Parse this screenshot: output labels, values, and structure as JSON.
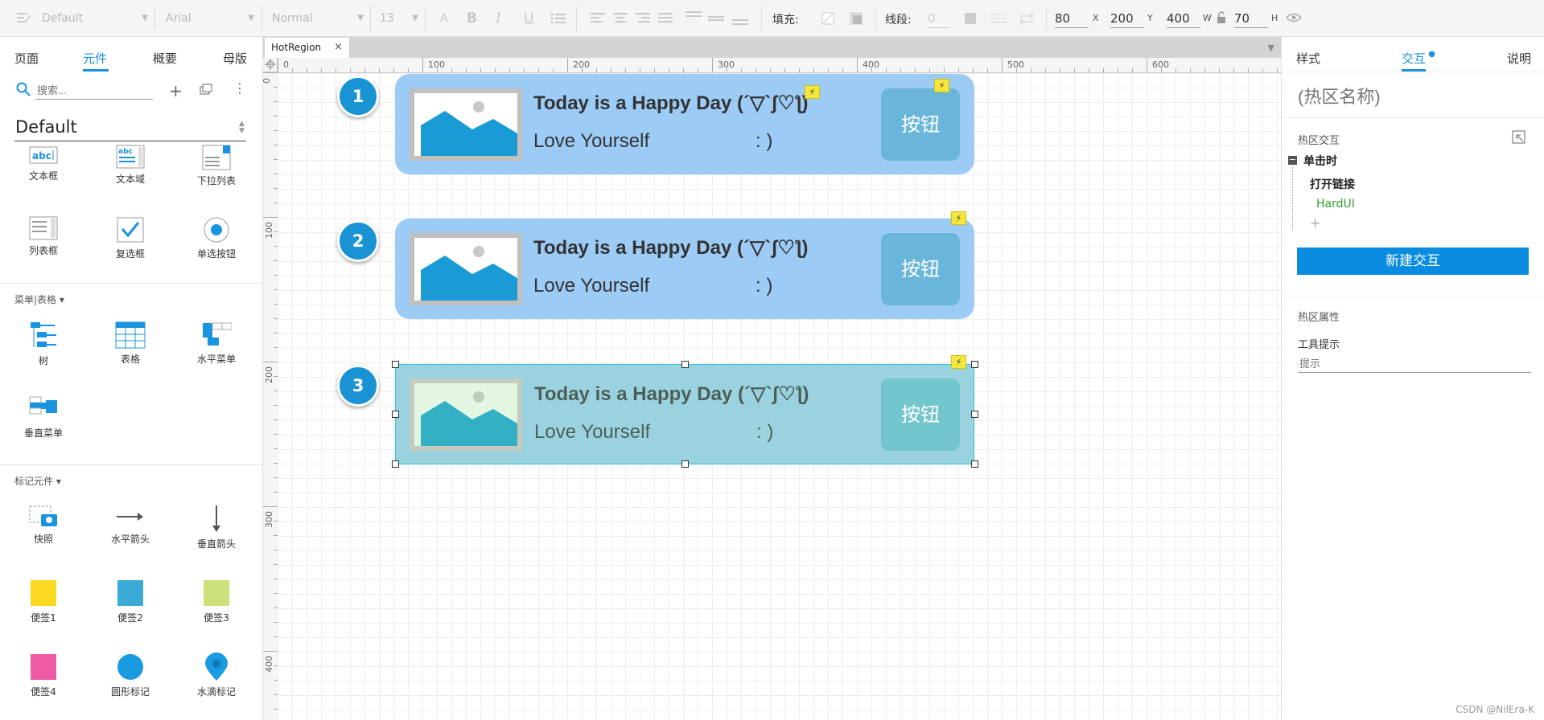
{
  "toolbar": {
    "style_select": "Default",
    "font_select": "Arial",
    "weight_select": "Normal",
    "size_select": "13",
    "fill_label": "填充:",
    "stroke_label": "线段:",
    "stroke_value": "0",
    "x_value": "80",
    "x_unit": "X",
    "y_value": "200",
    "y_unit": "Y",
    "w_value": "400",
    "w_unit": "W",
    "h_value": "70",
    "h_unit": "H"
  },
  "left_panel": {
    "tabs": [
      "页面",
      "元件",
      "概要",
      "母版"
    ],
    "active_tab": "元件",
    "search_placeholder": "搜索...",
    "library_name": "Default",
    "form_widgets": [
      {
        "label": "文本框",
        "icon": "text-box-icon"
      },
      {
        "label": "文本域",
        "icon": "text-area-icon"
      },
      {
        "label": "下拉列表",
        "icon": "dropdown-list-icon"
      },
      {
        "label": "列表框",
        "icon": "list-box-icon"
      },
      {
        "label": "复选框",
        "icon": "checkbox-icon"
      },
      {
        "label": "单选按钮",
        "icon": "radio-button-icon"
      }
    ],
    "menu_section": "菜单|表格",
    "menu_widgets": [
      {
        "label": "树",
        "icon": "tree-icon"
      },
      {
        "label": "表格",
        "icon": "table-icon"
      },
      {
        "label": "水平菜单",
        "icon": "horizontal-menu-icon"
      },
      {
        "label": "垂直菜单",
        "icon": "vertical-menu-icon"
      }
    ],
    "markup_section": "标记元件",
    "markup_widgets": [
      {
        "label": "快照",
        "icon": "snapshot-icon"
      },
      {
        "label": "水平箭头",
        "icon": "horizontal-arrow-icon"
      },
      {
        "label": "垂直箭头",
        "icon": "vertical-arrow-icon"
      },
      {
        "label": "便签1",
        "icon": "sticky-note-yellow-icon",
        "color": "#fbd921"
      },
      {
        "label": "便签2",
        "icon": "sticky-note-blue-icon",
        "color": "#3caad6"
      },
      {
        "label": "便签3",
        "icon": "sticky-note-green-icon",
        "color": "#cde17a"
      },
      {
        "label": "便签4",
        "icon": "sticky-note-pink-icon",
        "color": "#ef5ba5"
      },
      {
        "label": "圆形标记",
        "icon": "circle-marker-icon",
        "color": "#1a9ae0"
      },
      {
        "label": "水滴标记",
        "icon": "drop-marker-icon",
        "color": "#1a9ae0"
      }
    ]
  },
  "document_tab": "HotRegion",
  "rulers": {
    "h_labels": [
      "0",
      "100",
      "200",
      "300",
      "400",
      "500",
      "600"
    ],
    "v_labels": [
      "0",
      "100",
      "200",
      "300",
      "400"
    ]
  },
  "cards": [
    {
      "badge": "1",
      "title": "Today is a Happy Day (´▽`ʃ♡ƪ)",
      "subtitle": "Love Yourself",
      "colon": ":  )",
      "button": "按钮"
    },
    {
      "badge": "2",
      "title": "Today is a Happy Day (´▽`ʃ♡ƪ)",
      "subtitle": "Love Yourself",
      "colon": ":  )",
      "button": "按钮"
    },
    {
      "badge": "3",
      "title": "Today is a Happy Day (´▽`ʃ♡ƪ)",
      "subtitle": "Love Yourself",
      "colon": ":  )",
      "button": "按钮"
    }
  ],
  "right_panel": {
    "tabs": [
      "样式",
      "交互",
      "说明"
    ],
    "active_tab": "交互",
    "name_placeholder": "(热区名称)",
    "interaction_header": "热区交互",
    "event": "单击时",
    "action": "打开链接",
    "target": "HardUI",
    "add": "+",
    "new_button": "新建交互",
    "props_header": "热区属性",
    "tooltip_label": "工具提示",
    "tooltip_placeholder": "提示",
    "accent": "#0a8de0"
  },
  "watermark": "CSDN @NilEra-K"
}
